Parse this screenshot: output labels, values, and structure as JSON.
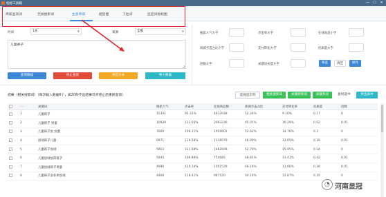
{
  "window": {
    "title": "指标工具箱",
    "min": "—",
    "max": "☐",
    "close": "✕"
  },
  "tabs": [
    "商家查询词",
    "无线搜索词",
    "生意参谋",
    "趋势图",
    "下拉词",
    "监控词指标图"
  ],
  "active_tab": 2,
  "form": {
    "time_label": "时间",
    "time_value": "1天",
    "source_label": "来源",
    "source_value": "全部",
    "keyword": "儿童裤子"
  },
  "buttons": {
    "query": "查询数据",
    "stop": "停止查询",
    "clear": "清空文本",
    "import": "导入数据"
  },
  "filters": {
    "l1": "搜索人气大于",
    "l2": "点击率大于",
    "l3": "在线商品小于",
    "l4": "商城点击占比小于",
    "l5": "支付转化大于",
    "l6": "优质度大于",
    "l7": "倍数大于",
    "l8": "关键词长度大于",
    "filter": "筛选",
    "clear": "清空",
    "save": "保存"
  },
  "result": {
    "text": "结果（相关搜索词）（单次载入数据6个，如20秒不出结果可点停止后重新查询）",
    "select_btn": "选择显示列",
    "b1": "相关搜索词",
    "b2": "关联修饰词",
    "b3": "关联热词",
    "copy": "复制选中",
    "export": "导出表中"
  },
  "table": {
    "headers": [
      "...",
      "关键词",
      "搜索人气",
      "点击率",
      "在线商品数",
      "商城点击占比",
      "支付转化率",
      "优质度",
      "倍数"
    ],
    "rows": [
      [
        "1",
        "儿童裤子",
        "15341",
        "95.31%",
        "4612938",
        "52.34%",
        "9.10%",
        "0.17",
        "0"
      ],
      [
        "2",
        "儿童裤子 男童",
        "10929",
        "112.03%",
        "2093236",
        "45.01%",
        "16.29%",
        "0.52",
        "0.01"
      ],
      [
        "3",
        "儿童裤子女 女童",
        "7669",
        "106.11%",
        "1950601",
        "52.62%",
        "14.76%",
        "0.3",
        "0"
      ],
      [
        "4",
        "加绒裤子儿童",
        "6971",
        "119.58%",
        "1316979",
        "46.00%",
        "12.05%",
        "0.39",
        "0.01"
      ],
      [
        "5",
        "儿童裤子加绒",
        "5603",
        "111.68%",
        "1462609",
        "52.79%",
        "15.95%",
        "0.34",
        "0"
      ],
      [
        "6",
        "儿童加绒加厚裤子",
        "5045",
        "106.86%",
        "754685",
        "48.81%",
        "11.41%",
        "0.42",
        "0.01"
      ],
      [
        "7",
        "儿童加绒裤子男童",
        "4990",
        "120.14%",
        "1001529",
        "46.19%",
        "13.66%",
        "0.38",
        "0.01"
      ],
      [
        "8",
        "儿童裤子女冬季加绒",
        "4468",
        "118.41%",
        "987520",
        "50.10%",
        "12.87%",
        "0.35",
        "0"
      ]
    ]
  },
  "watermark": {
    "icon": "wechat-icon",
    "glyph": "◔",
    "text": "河南显冠"
  },
  "colors": {
    "accent": "#3a8ee6",
    "red": "#e0242a",
    "blue_btn": "#3c87d6",
    "red_btn": "#e04b3a",
    "orange_btn": "#f5a623",
    "teal_btn": "#2eb8c8",
    "green_btn": "#3cc15a"
  }
}
